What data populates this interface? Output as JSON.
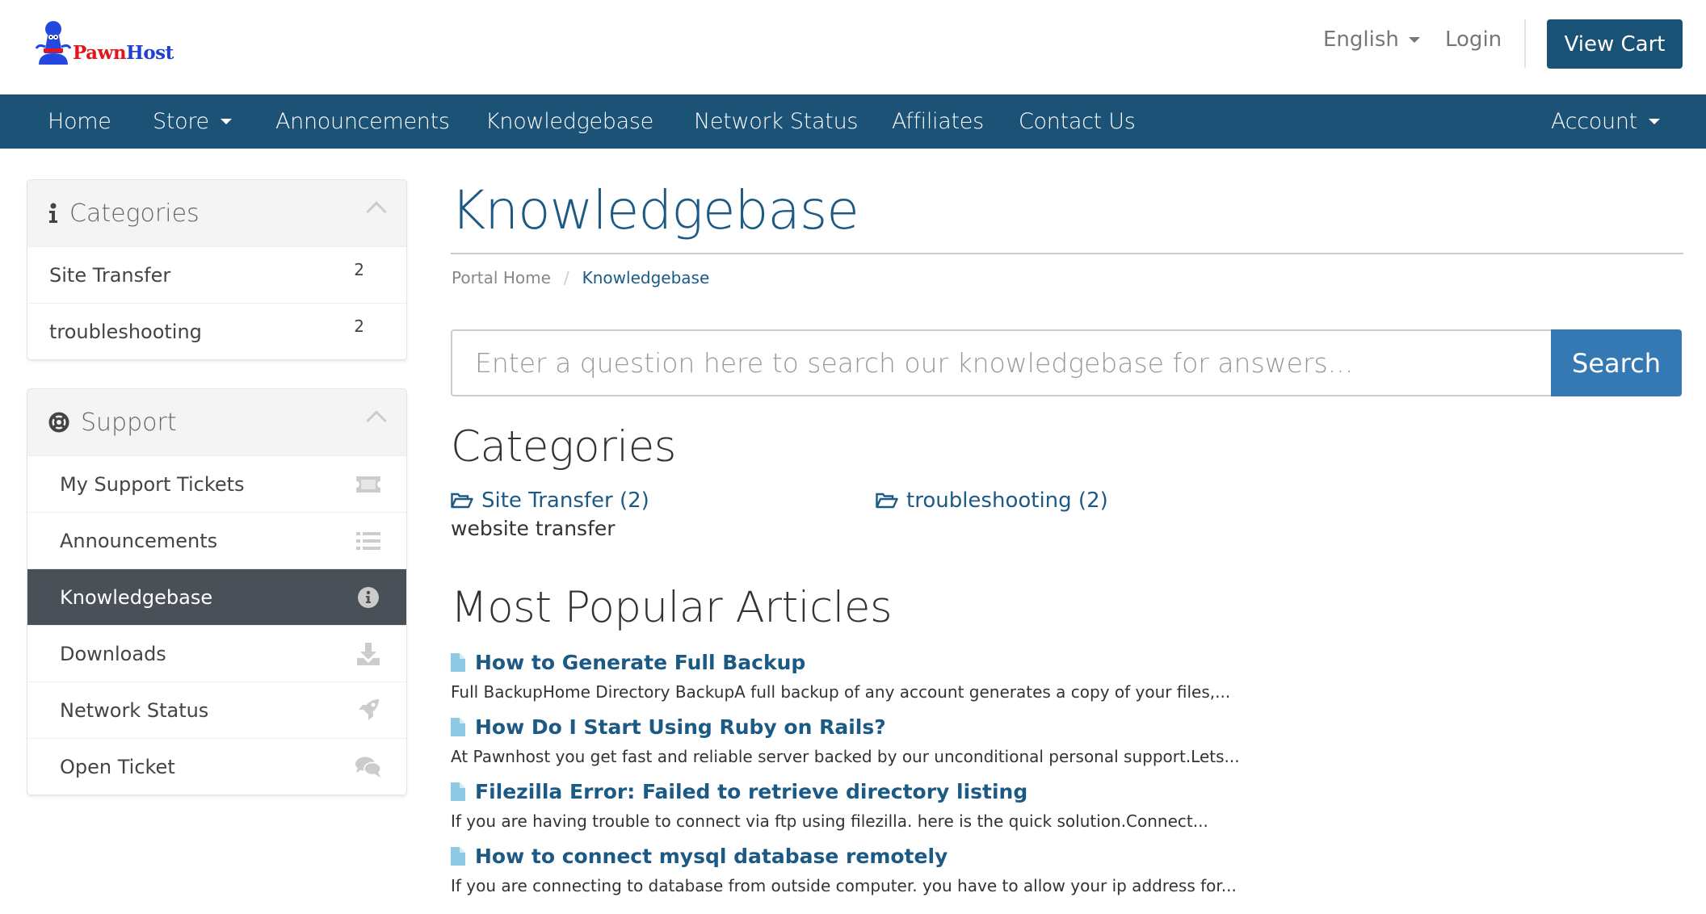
{
  "brand": {
    "name_part1": "Pawn",
    "name_part2": "Host",
    "primary_color": "#1b5276",
    "accent_red": "#e8141c",
    "accent_blue": "#1f3fd8"
  },
  "header": {
    "language": "English",
    "login": "Login",
    "view_cart": "View Cart"
  },
  "nav": {
    "items": [
      {
        "label": "Home",
        "has_caret": false
      },
      {
        "label": "Store",
        "has_caret": true
      },
      {
        "label": "Announcements",
        "has_caret": false
      },
      {
        "label": "Knowledgebase",
        "has_caret": false
      },
      {
        "label": "Network Status",
        "has_caret": false
      },
      {
        "label": "Affiliates",
        "has_caret": false
      },
      {
        "label": "Contact Us",
        "has_caret": false
      }
    ],
    "account": "Account"
  },
  "sidebar": {
    "categories_panel": {
      "title": "Categories",
      "icon": "info-icon",
      "items": [
        {
          "label": "Site Transfer",
          "count": "2"
        },
        {
          "label": "troubleshooting",
          "count": "2"
        }
      ]
    },
    "support_panel": {
      "title": "Support",
      "icon": "life-ring-icon",
      "items": [
        {
          "label": "My Support Tickets",
          "icon": "ticket-icon",
          "active": false
        },
        {
          "label": "Announcements",
          "icon": "list-icon",
          "active": false
        },
        {
          "label": "Knowledgebase",
          "icon": "info-circle-icon",
          "active": true
        },
        {
          "label": "Downloads",
          "icon": "download-icon",
          "active": false
        },
        {
          "label": "Network Status",
          "icon": "rocket-icon",
          "active": false
        },
        {
          "label": "Open Ticket",
          "icon": "comments-icon",
          "active": false
        }
      ]
    }
  },
  "main": {
    "title": "Knowledgebase",
    "breadcrumb": {
      "home": "Portal Home",
      "separator": "/",
      "current": "Knowledgebase"
    },
    "search": {
      "placeholder": "Enter a question here to search our knowledgebase for answers...",
      "value": "",
      "button": "Search"
    },
    "categories_heading": "Categories",
    "categories": [
      {
        "label": "Site Transfer (2)",
        "description": "website transfer"
      },
      {
        "label": "troubleshooting (2)",
        "description": ""
      }
    ],
    "popular_heading": "Most Popular Articles",
    "articles": [
      {
        "title": "How to Generate Full Backup",
        "excerpt": "Full BackupHome Directory BackupA full backup of any account generates a copy of your files,..."
      },
      {
        "title": "How Do I Start Using Ruby on Rails?",
        "excerpt": "At Pawnhost you get fast and reliable server backed by our unconditional personal support.Lets..."
      },
      {
        "title": "Filezilla Error: Failed to retrieve directory listing",
        "excerpt": "If you are having trouble to connect via ftp using filezilla. here is the quick solution.Connect..."
      },
      {
        "title": "How to connect mysql database remotely",
        "excerpt": "If you are connecting to database from outside computer. you have to allow your ip address for..."
      }
    ]
  }
}
